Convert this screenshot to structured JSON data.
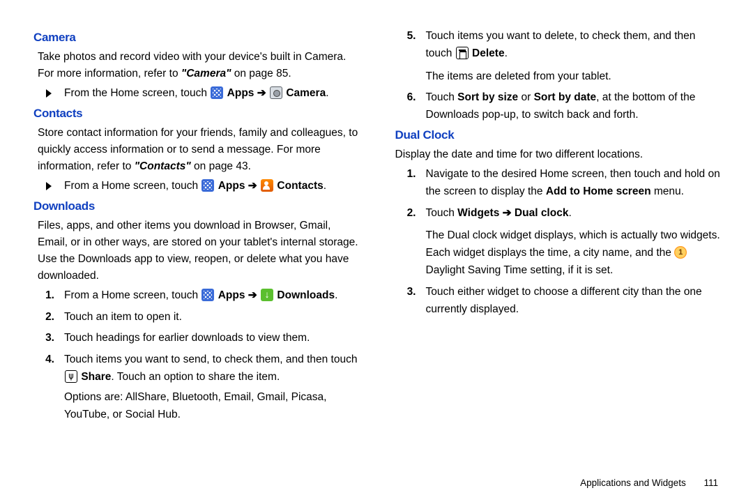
{
  "left": {
    "camera": {
      "heading": "Camera",
      "p1a": "Take photos and record video with your device's built in Camera. For more information, refer to ",
      "p1b": "\"Camera\"",
      "p1c": "  on page 85.",
      "nav_a": "From the Home screen, touch ",
      "apps": "Apps",
      "nav_b": "Camera",
      "period": "."
    },
    "contacts": {
      "heading": "Contacts",
      "p1a": "Store contact information for your friends, family and colleagues, to quickly access information or to send a message. For more information, refer to ",
      "p1b": "\"Contacts\"",
      "p1c": "  on page 43.",
      "nav_a": "From a Home screen, touch ",
      "apps": "Apps",
      "nav_b": "Contacts",
      "period": "."
    },
    "downloads": {
      "heading": "Downloads",
      "p1": "Files, apps, and other items you download in Browser, Gmail, Email, or in other ways, are stored on your tablet's internal storage. Use the Downloads app to view, reopen, or delete what you have downloaded.",
      "s1_a": "From a Home screen, touch ",
      "apps": "Apps",
      "s1_b": "Downloads",
      "period": ".",
      "s2": "Touch an item to open it.",
      "s3": "Touch headings for earlier downloads to view them.",
      "s4_a": "Touch items you want to send, to check them, and then touch ",
      "s4_share": "Share",
      "s4_b": ". Touch an option to share the item.",
      "s4_c": "Options are: AllShare, Bluetooth, Email, Gmail, Picasa, YouTube, or Social Hub."
    }
  },
  "right": {
    "downloads": {
      "s5_a": "Touch items you want to delete, to check them, and then touch ",
      "s5_delete": "Delete",
      "s5_b": ".",
      "s5_c": "The items are deleted from your tablet.",
      "s6_a": "Touch ",
      "s6_b": "Sort by size",
      "s6_c": " or ",
      "s6_d": "Sort by date",
      "s6_e": ", at the bottom of the Downloads pop-up, to switch back and forth."
    },
    "dualclock": {
      "heading": "Dual Clock",
      "p1": "Display the date and time for two different locations.",
      "s1_a": "Navigate to the desired Home screen, then touch and hold on the screen to display the ",
      "s1_b": "Add to Home screen",
      "s1_c": " menu.",
      "s2_a": "Touch ",
      "s2_b": "Widgets",
      "s2_c": "Dual clock",
      "s2_d": ".",
      "s2_e": "The Dual clock widget displays, which is actually two widgets. Each widget displays the time, a city name, and the ",
      "s2_f": " Daylight Saving Time setting, if it is set.",
      "s3": "Touch either widget to choose a different city than the one currently displayed."
    }
  },
  "footer": {
    "section": "Applications and Widgets",
    "page": "111"
  },
  "marks": {
    "n1": "1.",
    "n2": "2.",
    "n3": "3.",
    "n4": "4.",
    "n5": "5.",
    "n6": "6.",
    "arrow": " ➔ "
  }
}
